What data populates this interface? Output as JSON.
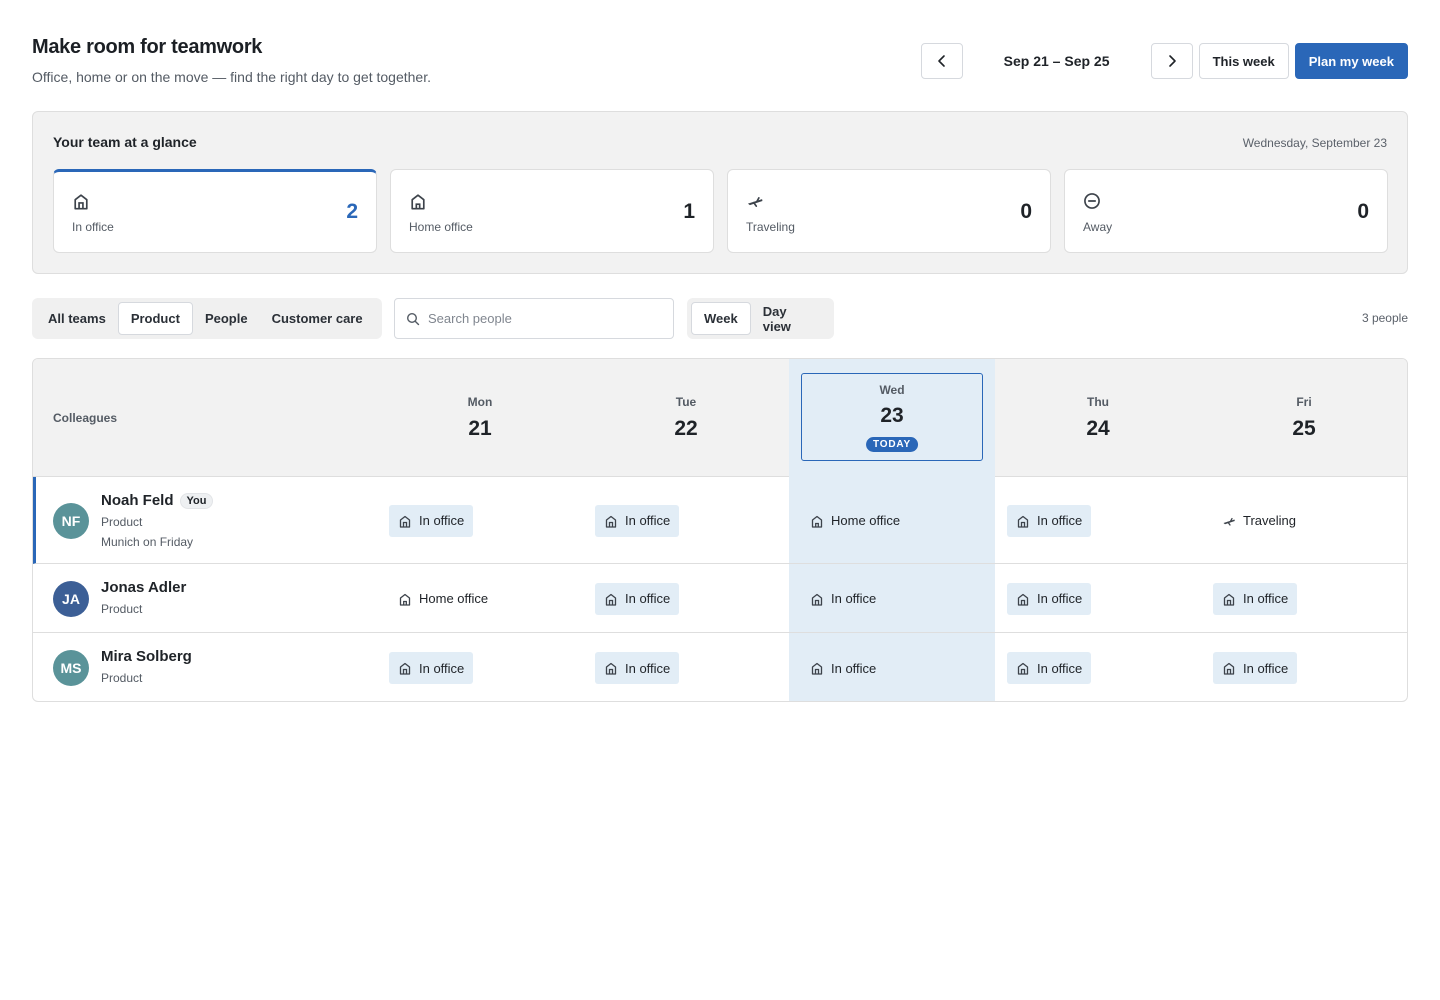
{
  "header": {
    "title": "Make room for teamwork",
    "subtitle": "Office, home or on the move — find the right day to get together."
  },
  "week_nav": {
    "range": "Sep 21 – Sep 25",
    "this_week_label": "This week",
    "plan_label": "Plan my week"
  },
  "glance": {
    "title": "Your team at a glance",
    "date": "Wednesday, September 23",
    "stats": [
      {
        "icon": "building-icon",
        "label": "In office",
        "value": "2",
        "active": true
      },
      {
        "icon": "house-icon",
        "label": "Home office",
        "value": "1",
        "active": false
      },
      {
        "icon": "plane-icon",
        "label": "Traveling",
        "value": "0",
        "active": false
      },
      {
        "icon": "minus-circle-icon",
        "label": "Away",
        "value": "0",
        "active": false
      }
    ]
  },
  "filters": {
    "teams": [
      "All teams",
      "Product",
      "People",
      "Customer care"
    ],
    "selected_team": "Product",
    "search_placeholder": "Search people",
    "views": [
      "Week",
      "Day view"
    ],
    "selected_view": "Week",
    "people_count": "3 people"
  },
  "schedule": {
    "colleagues_label": "Colleagues",
    "today_badge": "TODAY",
    "days": [
      {
        "name": "Mon",
        "num": "21",
        "today": false
      },
      {
        "name": "Tue",
        "num": "22",
        "today": false
      },
      {
        "name": "Wed",
        "num": "23",
        "today": true
      },
      {
        "name": "Thu",
        "num": "24",
        "today": false
      },
      {
        "name": "Fri",
        "num": "25",
        "today": false
      }
    ],
    "people": [
      {
        "initials": "NF",
        "name": "Noah Feld",
        "badge": "You",
        "team": "Product",
        "note": "Munich on Friday",
        "avatar_color": "#5a9399",
        "is_me": true,
        "statuses": [
          "In office",
          "In office",
          "Home office",
          "In office",
          "Traveling"
        ]
      },
      {
        "initials": "JA",
        "name": "Jonas Adler",
        "badge": "",
        "team": "Product",
        "note": "",
        "avatar_color": "#3c5f96",
        "is_me": false,
        "statuses": [
          "Home office",
          "In office",
          "In office",
          "In office",
          "In office"
        ]
      },
      {
        "initials": "MS",
        "name": "Mira Solberg",
        "badge": "",
        "team": "Product",
        "note": "",
        "avatar_color": "#5a9399",
        "is_me": false,
        "statuses": [
          "In office",
          "In office",
          "In office",
          "In office",
          "In office"
        ]
      }
    ]
  },
  "colors": {
    "accent": "#2a67b8",
    "today_tint": "#e2edf6",
    "panel": "#f2f2f2"
  }
}
